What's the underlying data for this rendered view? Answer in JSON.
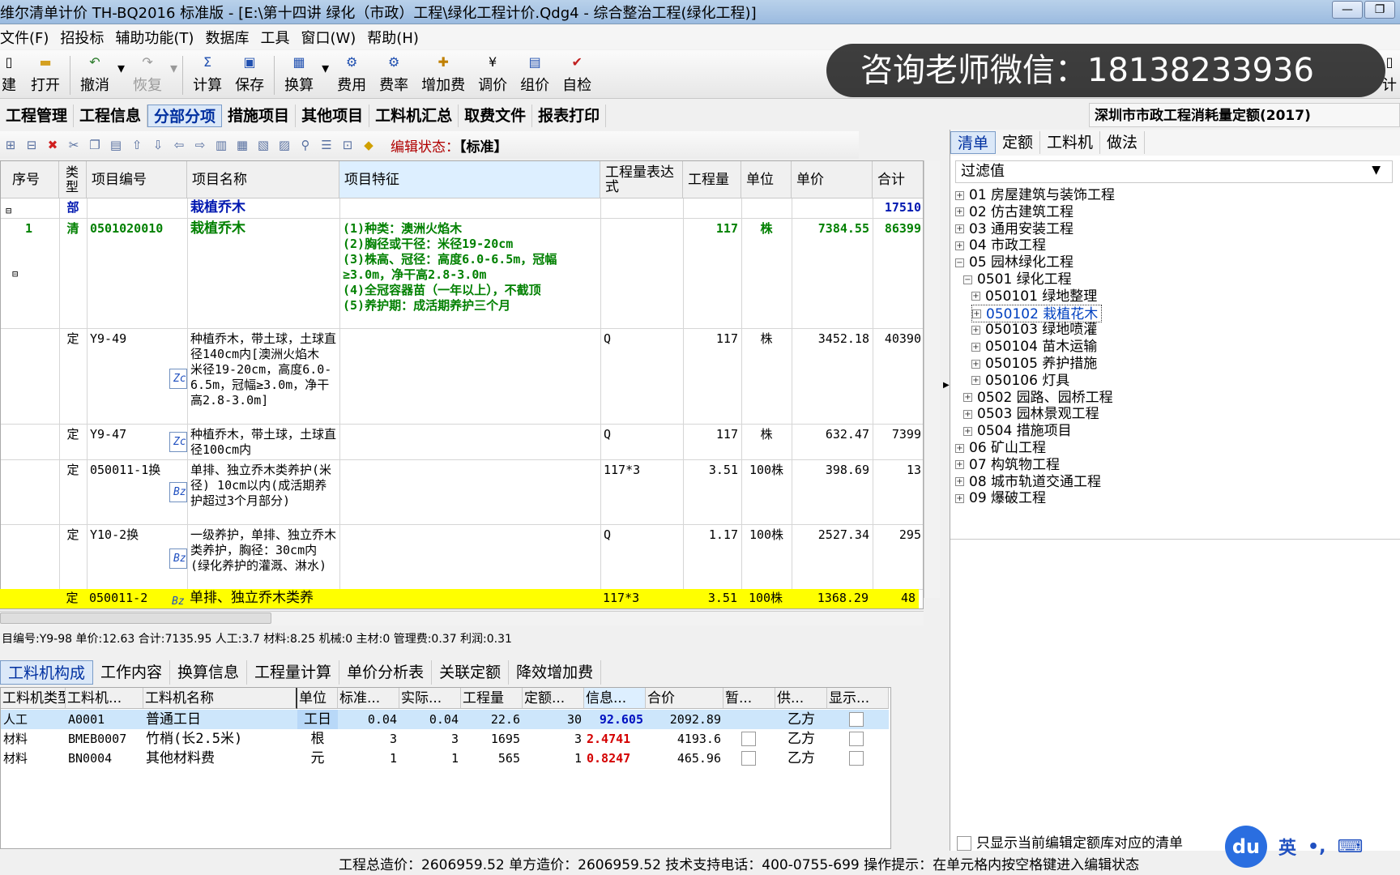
{
  "window": {
    "title": "维尔清单计价 TH-BQ2016 标准版 - [E:\\第十四讲 绿化（市政）工程\\绿化工程计价.Qdg4 - 综合整治工程(绿化工程)]",
    "minimize": "—",
    "restore": "❐"
  },
  "menu": [
    "文件(F)",
    "招投标",
    "辅助功能(T)",
    "数据库",
    "工具",
    "窗口(W)",
    "帮助(H)"
  ],
  "toolbar": {
    "new": "建",
    "open": "打开",
    "undo": "撤消",
    "redo": "恢复",
    "calc": "计算",
    "save": "保存",
    "convert": "换算",
    "fee": "费用",
    "fee_rate": "费率",
    "add_fee": "增加费",
    "adjust_price": "调价",
    "group_price": "组价",
    "self_check": "自检",
    "extra": "计"
  },
  "watermark": "咨询老师微信：18138233936",
  "tabs": [
    "工程管理",
    "工程信息",
    "分部分项",
    "措施项目",
    "其他项目",
    "工料机汇总",
    "取费文件",
    "报表打印"
  ],
  "quota_title": "深圳市市政工程消耗量定额(2017)",
  "edit_state": {
    "label": "编辑状态：",
    "value": "【标准】"
  },
  "grid": {
    "headers": [
      "序号",
      "类型",
      "项目编号",
      "项目名称",
      "项目特征",
      "工程量表达式",
      "工程量",
      "单位",
      "单价",
      "合计"
    ],
    "rows": [
      {
        "no": "",
        "type": "部",
        "code": "",
        "name": "栽植乔木",
        "feature": "",
        "expr": "",
        "qty": "",
        "unit": "",
        "price": "",
        "total": "17510"
      },
      {
        "no": "1",
        "type": "清",
        "code": "0501020010",
        "name": "栽植乔木",
        "feature": "(1)种类：澳洲火焰木\n(2)胸径或干径：米径19-20cm\n(3)株高、冠径：高度6.0-6.5m，冠幅≥3.0m，净干高2.8-3.0m\n(4)全冠容器苗（一年以上），不截顶\n(5)养护期：成活期养护三个月",
        "expr": "",
        "qty": "117",
        "unit": "株",
        "price": "7384.55",
        "total": "86399"
      },
      {
        "no": "",
        "type": "定",
        "code": "Y9-49",
        "name": "种植乔木，带土球，土球直径140cm内[澳洲火焰木 米径19-20cm，高度6.0-6.5m，冠幅≥3.0m，净干高2.8-3.0m]",
        "badge": "Zc",
        "feature": "",
        "expr": "Q",
        "qty": "117",
        "unit": "株",
        "price": "3452.18",
        "total": "40390"
      },
      {
        "no": "",
        "type": "定",
        "code": "Y9-47",
        "name": "种植乔木，带土球，土球直径100cm内",
        "badge": "Zc",
        "feature": "",
        "expr": "Q",
        "qty": "117",
        "unit": "株",
        "price": "632.47",
        "total": "7399"
      },
      {
        "no": "",
        "type": "定",
        "code": "050011-1换",
        "name": "单排、独立乔木类养护(米径) 10cm以内(成活期养护超过3个月部分)",
        "badge": "Bz",
        "feature": "",
        "expr": "117*3",
        "qty": "3.51",
        "unit": "100株",
        "price": "398.69",
        "total": "13"
      },
      {
        "no": "",
        "type": "定",
        "code": "Y10-2换",
        "name": "一级养护，单排、独立乔木类养护，胸径：30cm内(绿化养护的灌溉、淋水)",
        "badge": "Bz",
        "feature": "",
        "expr": "Q",
        "qty": "1.17",
        "unit": "100株",
        "price": "2527.34",
        "total": "295"
      },
      {
        "no": "",
        "type": "定",
        "code": "050011-2",
        "name": "单排、独立乔木类养",
        "badge": "Bz",
        "feature": "",
        "expr": "117*3",
        "qty": "3.51",
        "unit": "100株",
        "price": "1368.29",
        "total": "48"
      }
    ]
  },
  "info_line": "目编号:Y9-98   单价:12.63   合计:7135.95   人工:3.7   材料:8.25   机械:0   主材:0   管理费:0.37   利润:0.31",
  "subtabs": [
    "工料机构成",
    "工作内容",
    "换算信息",
    "工程量计算",
    "单价分析表",
    "关联定额",
    "降效增加费"
  ],
  "subgrid": {
    "headers": [
      "工料机类型",
      "工料机...",
      "工料机名称",
      "单位",
      "标准...",
      "实际...",
      "工程量",
      "定额...",
      "信息...",
      "合价",
      "暂...",
      "供...",
      "显示..."
    ],
    "rows": [
      {
        "type": "人工",
        "code": "A0001",
        "name": "普通工日",
        "unit": "工日",
        "std": "0.04",
        "actual": "0.04",
        "qty": "22.6",
        "quota": "30",
        "info": "92.605",
        "sum": "2092.89",
        "supply": "乙方"
      },
      {
        "type": "材料",
        "code": "BMEB0007",
        "name": "竹梢(长2.5米)",
        "unit": "根",
        "std": "3",
        "actual": "3",
        "qty": "1695",
        "quota": "3",
        "info": "2.4741",
        "sum": "4193.6",
        "supply": "乙方"
      },
      {
        "type": "材料",
        "code": "BN0004",
        "name": "其他材料费",
        "unit": "元",
        "std": "1",
        "actual": "1",
        "qty": "565",
        "quota": "1",
        "info": "0.8247",
        "sum": "465.96",
        "supply": "乙方"
      }
    ]
  },
  "right_panel": {
    "tabs": [
      "清单",
      "定额",
      "工料机",
      "做法"
    ],
    "filter": "过滤值",
    "tree": [
      {
        "label": "01  房屋建筑与装饰工程",
        "level": 0,
        "sign": "+"
      },
      {
        "label": "02  仿古建筑工程",
        "level": 0,
        "sign": "+"
      },
      {
        "label": "03  通用安装工程",
        "level": 0,
        "sign": "+"
      },
      {
        "label": "04  市政工程",
        "level": 0,
        "sign": "+"
      },
      {
        "label": "05  园林绿化工程",
        "level": 0,
        "sign": "−"
      },
      {
        "label": "0501  绿化工程",
        "level": 1,
        "sign": "−"
      },
      {
        "label": "050101  绿地整理",
        "level": 2,
        "sign": "+"
      },
      {
        "label": "050102  栽植花木",
        "level": 2,
        "sign": "+",
        "selected": true
      },
      {
        "label": "050103  绿地喷灌",
        "level": 2,
        "sign": "+"
      },
      {
        "label": "050104  苗木运输",
        "level": 2,
        "sign": "+"
      },
      {
        "label": "050105  养护措施",
        "level": 2,
        "sign": "+"
      },
      {
        "label": "050106  灯具",
        "level": 2,
        "sign": "+"
      },
      {
        "label": "0502  园路、园桥工程",
        "level": 1,
        "sign": "+"
      },
      {
        "label": "0503  园林景观工程",
        "level": 1,
        "sign": "+"
      },
      {
        "label": "0504  措施项目",
        "level": 1,
        "sign": "+"
      },
      {
        "label": "06  矿山工程",
        "level": 0,
        "sign": "+"
      },
      {
        "label": "07  构筑物工程",
        "level": 0,
        "sign": "+"
      },
      {
        "label": "08  城市轨道交通工程",
        "level": 0,
        "sign": "+"
      },
      {
        "label": "09  爆破工程",
        "level": 0,
        "sign": "+"
      }
    ],
    "only_show": "只显示当前编辑定额库对应的清单"
  },
  "status": "工程总造价：2606959.52  单方造价：2606959.52  技术支持电话：400-0755-699  操作提示：在单元格内按空格键进入编辑状态",
  "ime": {
    "logo": "du",
    "lang": "英",
    "punct": "•,",
    "kbd": "⌨"
  }
}
